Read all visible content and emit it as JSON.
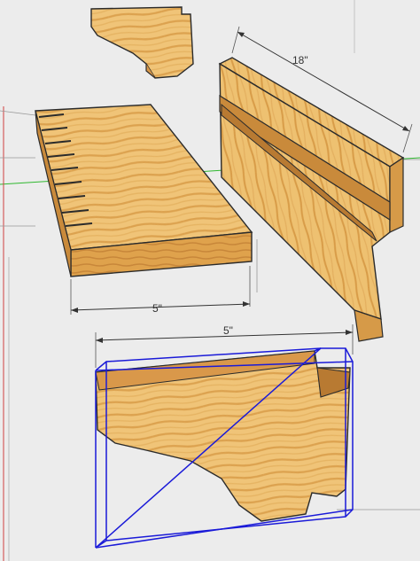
{
  "dimensions": {
    "shelf_depth": "5\"",
    "bracket_depth": "5\"",
    "back_length": "18\""
  },
  "colors": {
    "background": "#ececec",
    "wood_light": "#f2c77a",
    "wood_mid": "#e0a955",
    "wood_dark": "#c98a3b",
    "edge": "#2b2b2b",
    "selection": "#1a1ad8",
    "axis_green": "#2fb82f",
    "axis_red": "#d04040"
  },
  "parts": [
    "top-bracket",
    "shelf-board",
    "back-rail",
    "selected-bracket"
  ]
}
